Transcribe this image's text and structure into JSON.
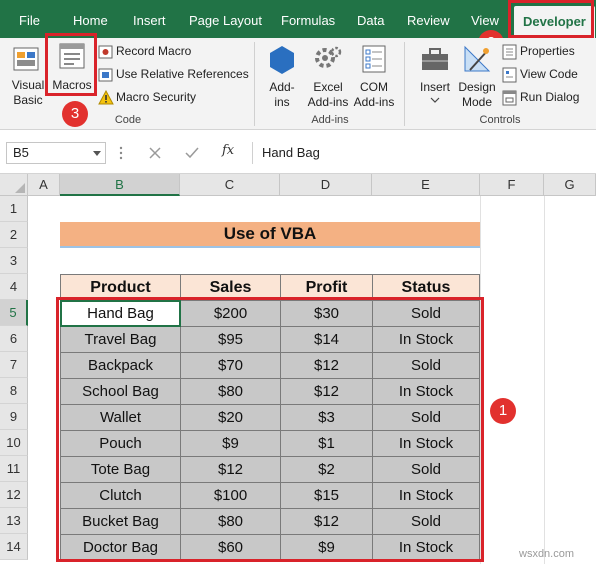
{
  "tabs": [
    {
      "id": "file",
      "label": "File"
    },
    {
      "id": "home",
      "label": "Home"
    },
    {
      "id": "insert",
      "label": "Insert"
    },
    {
      "id": "page_layout",
      "label": "Page Layout"
    },
    {
      "id": "formulas",
      "label": "Formulas"
    },
    {
      "id": "data",
      "label": "Data"
    },
    {
      "id": "review",
      "label": "Review"
    },
    {
      "id": "view",
      "label": "View"
    },
    {
      "id": "developer",
      "label": "Developer"
    }
  ],
  "ribbon": {
    "code": {
      "visual_basic": [
        "Visual",
        "Basic"
      ],
      "macros": "Macros",
      "record_macro": "Record Macro",
      "relative_refs": "Use Relative References",
      "macro_security": "Macro Security",
      "label": "Code"
    },
    "addins": {
      "addins": [
        "Add-",
        "ins"
      ],
      "excel_addins": [
        "Excel",
        "Add-ins"
      ],
      "com_addins": [
        "COM",
        "Add-ins"
      ],
      "label": "Add-ins"
    },
    "controls": {
      "insert": "Insert",
      "design_mode": [
        "Design",
        "Mode"
      ],
      "properties": "Properties",
      "view_code": "View Code",
      "run_dialog": "Run Dialog",
      "label": "Controls"
    }
  },
  "formula_bar": {
    "name_box": "B5",
    "fx": "fx",
    "content": "Hand Bag"
  },
  "columns": [
    "A",
    "B",
    "C",
    "D",
    "E",
    "F",
    "G"
  ],
  "rows": [
    "1",
    "2",
    "3",
    "4",
    "5",
    "6",
    "7",
    "8",
    "9",
    "10",
    "11",
    "12",
    "13",
    "14"
  ],
  "sheet": {
    "title": "Use of VBA",
    "headers": [
      "Product",
      "Sales",
      "Profit",
      "Status"
    ],
    "data": [
      [
        "Hand Bag",
        "$200",
        "$30",
        "Sold"
      ],
      [
        "Travel Bag",
        "$95",
        "$14",
        "In Stock"
      ],
      [
        "Backpack",
        "$70",
        "$12",
        "Sold"
      ],
      [
        "School Bag",
        "$80",
        "$12",
        "In Stock"
      ],
      [
        "Wallet",
        "$20",
        "$3",
        "Sold"
      ],
      [
        "Pouch",
        "$9",
        "$1",
        "In Stock"
      ],
      [
        "Tote Bag",
        "$12",
        "$2",
        "Sold"
      ],
      [
        "Clutch",
        "$100",
        "$15",
        "In Stock"
      ],
      [
        "Bucket Bag",
        "$80",
        "$12",
        "Sold"
      ],
      [
        "Doctor Bag",
        "$60",
        "$9",
        "In Stock"
      ]
    ]
  },
  "annotations": [
    "1",
    "2",
    "3"
  ],
  "watermark": "wsxdn.com",
  "colors": {
    "excel_green": "#217346",
    "highlight_red": "#d9232a",
    "header_fill": "#fbe5d6",
    "title_fill": "#f4b183",
    "body_fill": "#c8c8c8"
  }
}
